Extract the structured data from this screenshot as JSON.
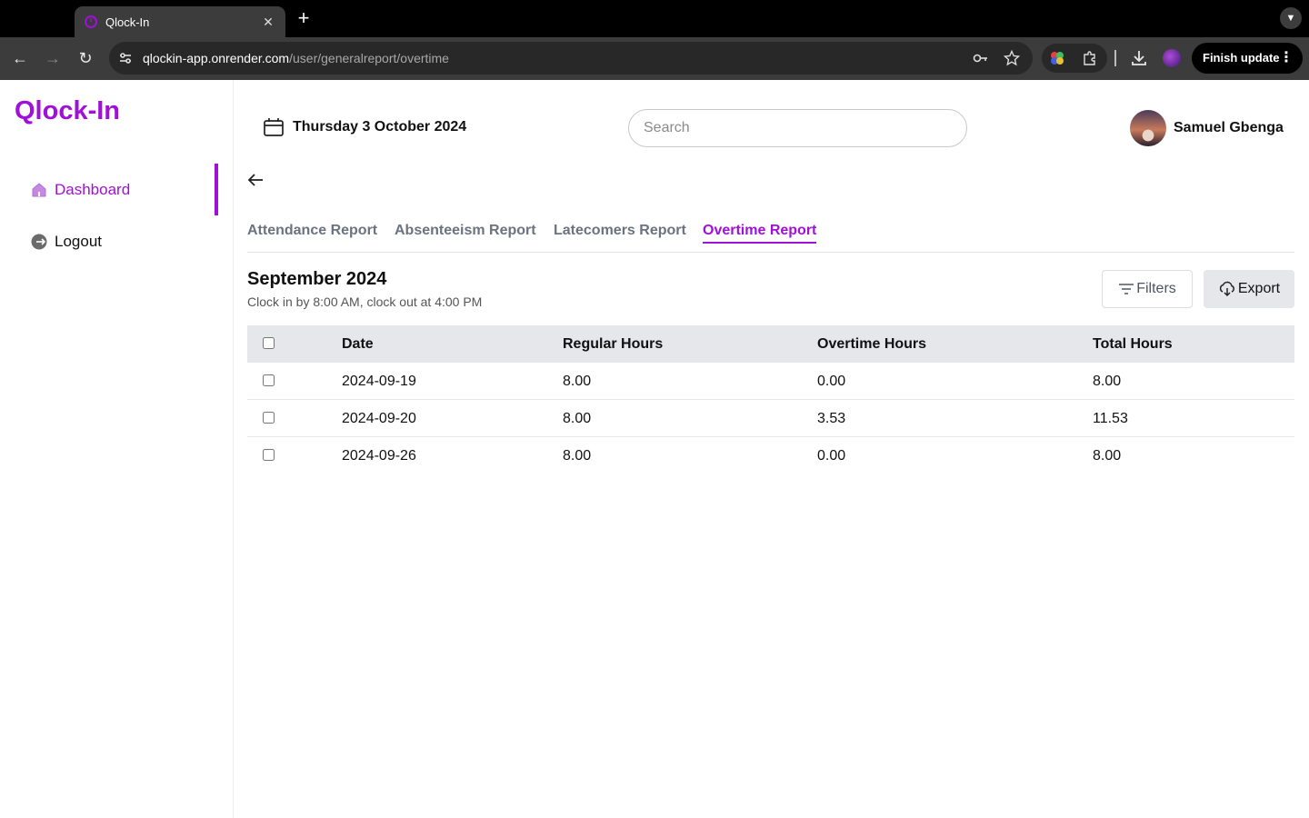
{
  "browser": {
    "tab_title": "Qlock-In",
    "url_host": "qlockin-app.onrender.com",
    "url_path": "/user/generalreport/overtime",
    "finish_update_label": "Finish update"
  },
  "app": {
    "logo": "Qlock-In",
    "accent_color": "#a010d8",
    "sidebar": {
      "items": [
        {
          "label": "Dashboard",
          "icon": "home-icon",
          "active": true
        },
        {
          "label": "Logout",
          "icon": "logout-icon",
          "active": false
        }
      ]
    },
    "header": {
      "date": "Thursday 3 October 2024",
      "search_placeholder": "Search",
      "user_name": "Samuel Gbenga"
    },
    "report_tabs": [
      {
        "label": "Attendance Report",
        "active": false
      },
      {
        "label": "Absenteeism Report",
        "active": false
      },
      {
        "label": "Latecomers Report",
        "active": false
      },
      {
        "label": "Overtime Report",
        "active": true
      }
    ],
    "report": {
      "period": "September 2024",
      "rule": "Clock in by 8:00 AM, clock out at 4:00 PM",
      "filters_label": "Filters",
      "export_label": "Export",
      "columns": [
        "Date",
        "Regular Hours",
        "Overtime Hours",
        "Total Hours"
      ],
      "rows": [
        {
          "date": "2024-09-19",
          "regular": "8.00",
          "overtime": "0.00",
          "total": "8.00"
        },
        {
          "date": "2024-09-20",
          "regular": "8.00",
          "overtime": "3.53",
          "total": "11.53"
        },
        {
          "date": "2024-09-26",
          "regular": "8.00",
          "overtime": "0.00",
          "total": "8.00"
        }
      ]
    }
  }
}
